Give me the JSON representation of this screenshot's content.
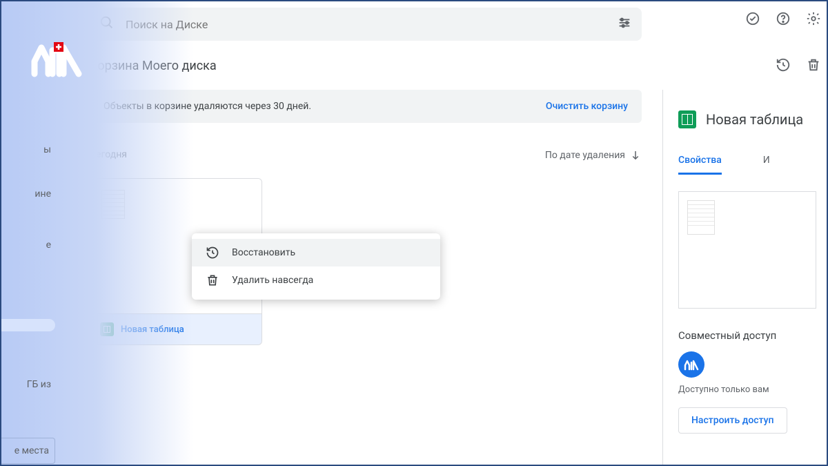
{
  "search": {
    "placeholder": "Поиск на Диске"
  },
  "page": {
    "title": "Корзина Моего диска"
  },
  "banner": {
    "text": "Объекты в корзине удаляются через 30 дней.",
    "action": "Очистить корзину"
  },
  "section": {
    "today": "Сегодня",
    "sort": "По дате удаления"
  },
  "file": {
    "name": "Новая таблица"
  },
  "context_menu": {
    "restore": "Восстановить",
    "delete": "Удалить навсегда"
  },
  "details": {
    "title": "Новая таблица",
    "tab_properties": "Свойства",
    "tab_other": "И",
    "share_heading": "Совместный доступ",
    "share_sub": "Доступно только вам",
    "share_button": "Настроить доступ"
  },
  "sidebar": {
    "hint1": "ы",
    "hint2": "ине",
    "hint3": "е",
    "storage": "ГБ из",
    "buy": "е места"
  }
}
